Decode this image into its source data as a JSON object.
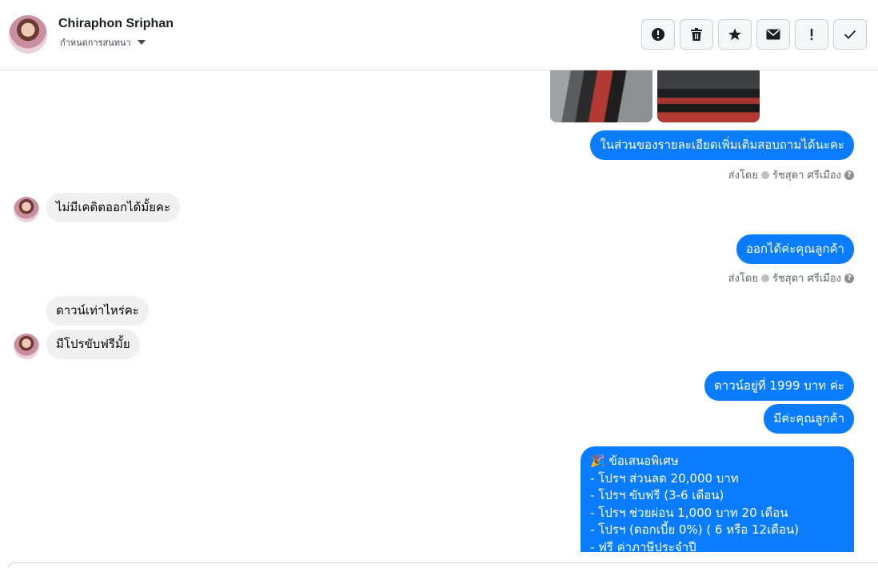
{
  "header": {
    "contact_name": "Chiraphon Sriphan",
    "settings_label": "กำหนดการสนทนา",
    "actions": [
      "report-icon",
      "trash-icon",
      "star-icon",
      "envelope-icon",
      "exclamation-icon",
      "check-icon"
    ]
  },
  "messages": {
    "m1": "ในส่วนของรายละเอียดเพิ่มเติมสอบถามได้นะคะ",
    "m2": "ไม่มีเคดิตออกได้มั้ยคะ",
    "m3": "ออกได้ค่ะคุณลูกค้า",
    "m4": "ดาวน์เท่าไหร่คะ",
    "m5": "มีโปรขับฟรีมั้ย",
    "m6": "ดาวน์อยู่ที่  1999  บาท  ค่ะ",
    "m7": "มีค่ะคุณลูกค้า"
  },
  "sent_by": {
    "label": "ส่งโดย",
    "name": "รัชสุดา ศรีเมือง"
  },
  "offer": {
    "icon": "🎉",
    "title": "ข้อเสนอพิเศษ",
    "lines": [
      "- โปรฯ ส่วนลด 20,000 บาท",
      "- โปรฯ ขับฟรี (3-6 เดือน)",
      "- โปรฯ ช่วยผ่อน 1,000 บาท 20 เดือน",
      "- โปรฯ (ดอกเบี้ย 0%) ( 6 หรือ 12เดือน)",
      "- ฟรี ค่าภาษีประจำปี"
    ]
  },
  "colors": {
    "outgoing_bubble": "#0a7cff",
    "incoming_bubble": "#f0f0f0"
  }
}
